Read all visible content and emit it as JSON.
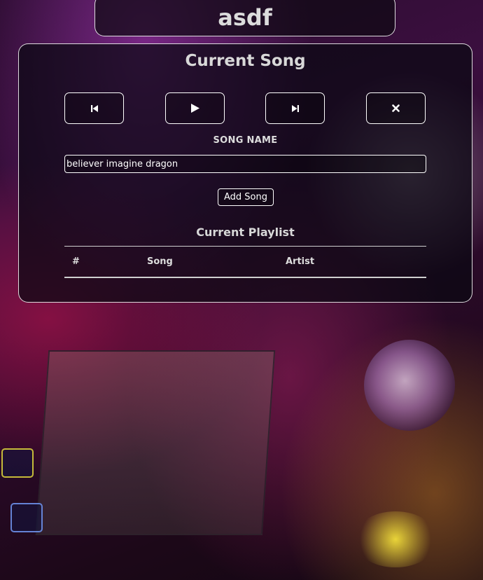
{
  "header": {
    "title": "asdf"
  },
  "player": {
    "heading": "Current Song",
    "controls": [
      {
        "name": "previous",
        "icon": "skip-previous-icon"
      },
      {
        "name": "play",
        "icon": "play-icon"
      },
      {
        "name": "next",
        "icon": "skip-next-icon"
      },
      {
        "name": "stop",
        "icon": "close-icon"
      }
    ]
  },
  "form": {
    "label": "SONG NAME",
    "song_value": "believer imagine dragon",
    "add_label": "Add Song"
  },
  "playlist": {
    "heading": "Current Playlist",
    "columns": [
      "#",
      "Song",
      "Artist"
    ],
    "rows": []
  }
}
